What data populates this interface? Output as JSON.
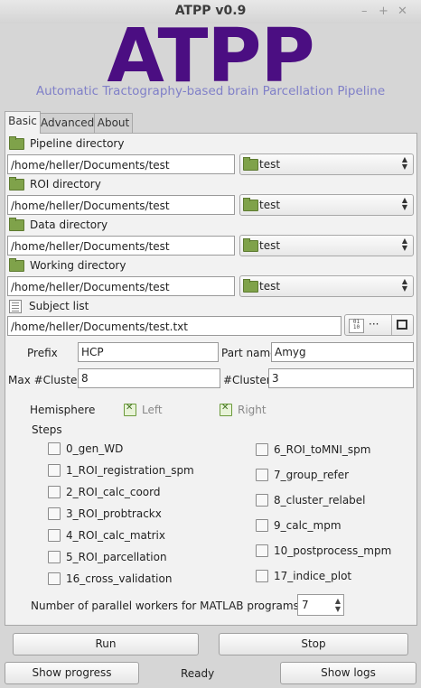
{
  "window": {
    "title": "ATPP v0.9"
  },
  "header": {
    "logo": "ATPP",
    "subtitle": "Automatic Tractography-based brain Parcellation Pipeline"
  },
  "tabs": [
    "Basic",
    "Advanced",
    "About"
  ],
  "dirs": [
    {
      "label": "Pipeline  directory",
      "path": "/home/heller/Documents/test",
      "combo": "test"
    },
    {
      "label": "ROI  directory",
      "path": "/home/heller/Documents/test",
      "combo": "test"
    },
    {
      "label": "Data  directory",
      "path": "/home/heller/Documents/test",
      "combo": "test"
    },
    {
      "label": "Working  directory",
      "path": "/home/heller/Documents/test",
      "combo": "test"
    }
  ],
  "subject": {
    "label": "Subject list",
    "path": "/home/heller/Documents/test.txt",
    "dots": "···"
  },
  "fields": {
    "prefix_label": "Prefix",
    "prefix": "HCP",
    "partname_label": "Part name",
    "partname": "Amyg",
    "maxclusters_label": "Max #Clusters",
    "maxclusters": "8",
    "clusters_label": "#Clusters",
    "clusters": "3"
  },
  "hemisphere": {
    "label": "Hemisphere",
    "left": "Left",
    "right": "Right",
    "left_checked": true,
    "right_checked": true
  },
  "steps": {
    "label": "Steps",
    "left": [
      "0_gen_WD",
      "1_ROI_registration_spm",
      "2_ROI_calc_coord",
      "3_ROI_probtrackx",
      "4_ROI_calc_matrix",
      "5_ROI_parcellation",
      "16_cross_validation"
    ],
    "right": [
      "6_ROI_toMNI_spm",
      "7_group_refer",
      "8_cluster_relabel",
      "9_calc_mpm",
      "10_postprocess_mpm",
      "17_indice_plot"
    ]
  },
  "workers": {
    "label": "Number of parallel workers for MATLAB programs",
    "value": "7"
  },
  "buttons": {
    "run": "Run",
    "stop": "Stop",
    "show_progress": "Show progress",
    "status": "Ready",
    "show_logs": "Show logs"
  }
}
